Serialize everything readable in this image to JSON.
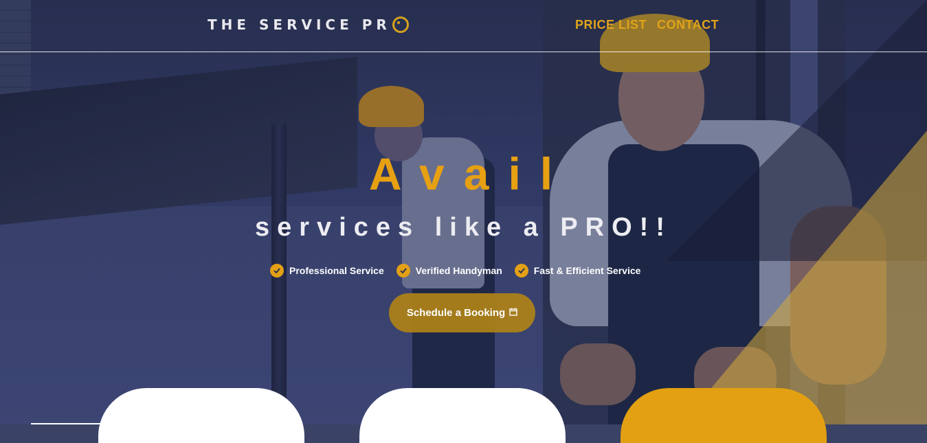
{
  "header": {
    "logo_text": "THE SERVICE PR",
    "nav": [
      {
        "label": "PRICE LIST"
      },
      {
        "label": "CONTACT"
      }
    ]
  },
  "hero": {
    "headline": "Avail",
    "subheadline": "services like a PRO!!",
    "features": [
      {
        "label": "Professional Service"
      },
      {
        "label": "Verified Handyman"
      },
      {
        "label": "Fast & Efficient Service"
      }
    ],
    "cta_label": "Schedule a Booking"
  },
  "colors": {
    "accent": "#e0a31a",
    "overlay": "#3a4266",
    "text_light": "#ececf2"
  },
  "icons": [
    "check-circle-icon",
    "calendar-icon",
    "logo-gear-icon"
  ]
}
